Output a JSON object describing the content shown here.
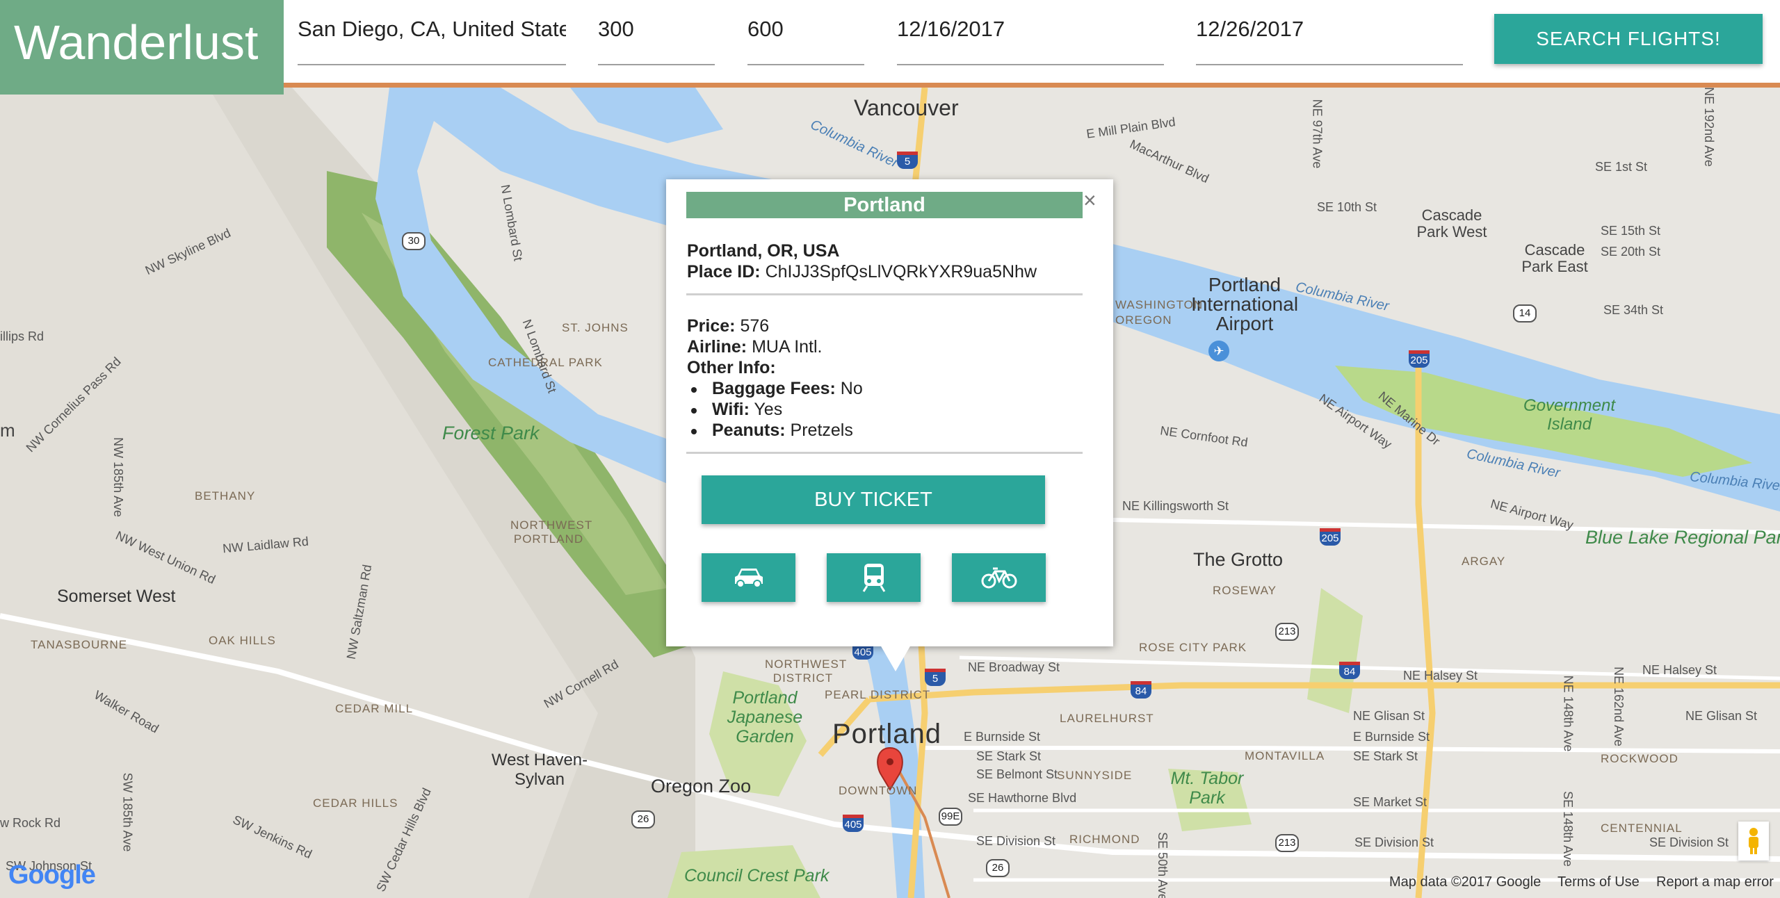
{
  "app": {
    "logo": "Wanderlust"
  },
  "search": {
    "origin": "San Diego, CA, United States",
    "min_price": "300",
    "max_price": "600",
    "depart_date": "12/16/2017",
    "return_date": "12/26/2017",
    "button": "SEARCH FLIGHTS!"
  },
  "popup": {
    "title": "Portland",
    "close": "×",
    "location": "Portland, OR, USA",
    "place_id_label": "Place ID:",
    "place_id": "ChIJJ3SpfQsLlVQRkYXR9ua5Nhw",
    "price_label": "Price:",
    "price": "576",
    "airline_label": "Airline:",
    "airline": "MUA Intl.",
    "other_info_label": "Other Info:",
    "other_info": [
      {
        "label": "Baggage Fees:",
        "value": "No"
      },
      {
        "label": "Wifi:",
        "value": "Yes"
      },
      {
        "label": "Peanuts:",
        "value": "Pretzels"
      }
    ],
    "buy_button": "BUY TICKET",
    "transport_icons": [
      "car-icon",
      "train-icon",
      "bicycle-icon"
    ]
  },
  "map": {
    "labels": {
      "vancouver": "Vancouver",
      "portland": "Portland",
      "forest_park": "Forest Park",
      "portland_intl_airport": "Portland International Airport",
      "government_island": "Government Island",
      "blue_lake": "Blue Lake Regional Par",
      "the_grotto": "The Grotto",
      "somerset_west": "Somerset West",
      "west_haven": "West Haven-Sylvan",
      "oregon_zoo": "Oregon Zoo",
      "japanese_garden": "Portland Japanese Garden",
      "mt_tabor": "Mt. Tabor Park",
      "council_crest": "Council Crest Park",
      "cascade_park_west": "Cascade Park West",
      "cascade_park_east": "Cascade Park East",
      "columbia_river": "Columbia River",
      "bethany": "BETHANY",
      "tanasbourne": "TANASBOURNE",
      "oak_hills": "OAK HILLS",
      "cedar_mill": "CEDAR MILL",
      "cedar_hills": "CEDAR HILLS",
      "northwest_portland": "NORTHWEST PORTLAND",
      "northwest_district": "NORTHWEST DISTRICT",
      "pearl_district": "PEARL DISTRICT",
      "downtown": "DOWNTOWN",
      "cathedral_park": "CATHEDRAL PARK",
      "st_johns": "ST. JOHNS",
      "laurelhurst": "LAURELHURST",
      "montavilla": "MONTAVILLA",
      "sunnyside": "SUNNYSIDE",
      "richmond": "RICHMOND",
      "roseway": "ROSEWAY",
      "rose_city_park": "ROSE CITY PARK",
      "argay": "ARGAY",
      "rockwood": "ROCKWOOD",
      "centennial": "CENTENNIAL",
      "ne_broadway": "NE Broadway St",
      "ne_halsey": "NE Halsey St",
      "ne_glisan": "NE Glisan St",
      "e_burnside": "E Burnside St",
      "se_stark": "SE Stark St",
      "se_belmont": "SE Belmont St",
      "se_hawthorne": "SE Hawthorne Blvd",
      "se_division": "SE Division St",
      "se_market": "SE Market St",
      "ne_killingsworth": "NE Killingsworth St",
      "ne_cornfoot": "NE Cornfoot Rd",
      "ne_airport_way": "NE Airport Way",
      "ne_marine_dr": "NE Marine Dr",
      "e_mill_plain": "E Mill Plain Blvd",
      "macarthur": "MacArthur Blvd",
      "se_1st": "SE 1st St",
      "se_10th": "SE 10th St",
      "se_15th": "SE 15th St",
      "se_20th": "SE 20th St",
      "se_34th": "SE 34th St",
      "nw_skyline": "NW Skyline Blvd",
      "nw_cornelius": "NW Cornelius Pass Rd",
      "nw_185th": "NW 185th Ave",
      "nw_laidlaw": "NW Laidlaw Rd",
      "nw_west_union": "NW West Union Rd",
      "nw_saltzman": "NW Saltzman Rd",
      "nw_cornell": "NW Cornell Rd",
      "walker_road": "Walker Road",
      "sw_185th": "SW 185th Ave",
      "sw_jenkins": "SW Jenkins Rd",
      "sw_cedar_hills": "SW Cedar Hills Blvd",
      "rock_rd": "w Rock Rd",
      "sw_johnson": "SW Johnson St",
      "n_lombard": "N Lombard St",
      "n_lombard2": "N Lombard St",
      "illips_rd": "illips Rd",
      "m_edge": "m",
      "washington": "WASHINGTON OREGON",
      "se_50th": "SE 50th Ave",
      "ne_148th": "NE 148th Ave",
      "ne_162nd": "NE 162nd Ave",
      "se_148th": "SE 148th Ave",
      "ne_97th": "NE 97th Ave",
      "ne_192nd": "NE 192nd Ave"
    },
    "footer": {
      "map_data": "Map data ©2017 Google",
      "terms": "Terms of Use",
      "report": "Report a map error",
      "google": "Google"
    },
    "colors": {
      "land": "#e8e6e1",
      "water": "#a9cff3",
      "park": "#cfe0a7",
      "forest": "#8fb56a",
      "road": "#ffffff",
      "highway": "#f6cf70",
      "accent": "#2ba69a",
      "logo_bg": "#6fab86",
      "header_accent": "#d98a52",
      "marker": "#e8453c"
    }
  }
}
